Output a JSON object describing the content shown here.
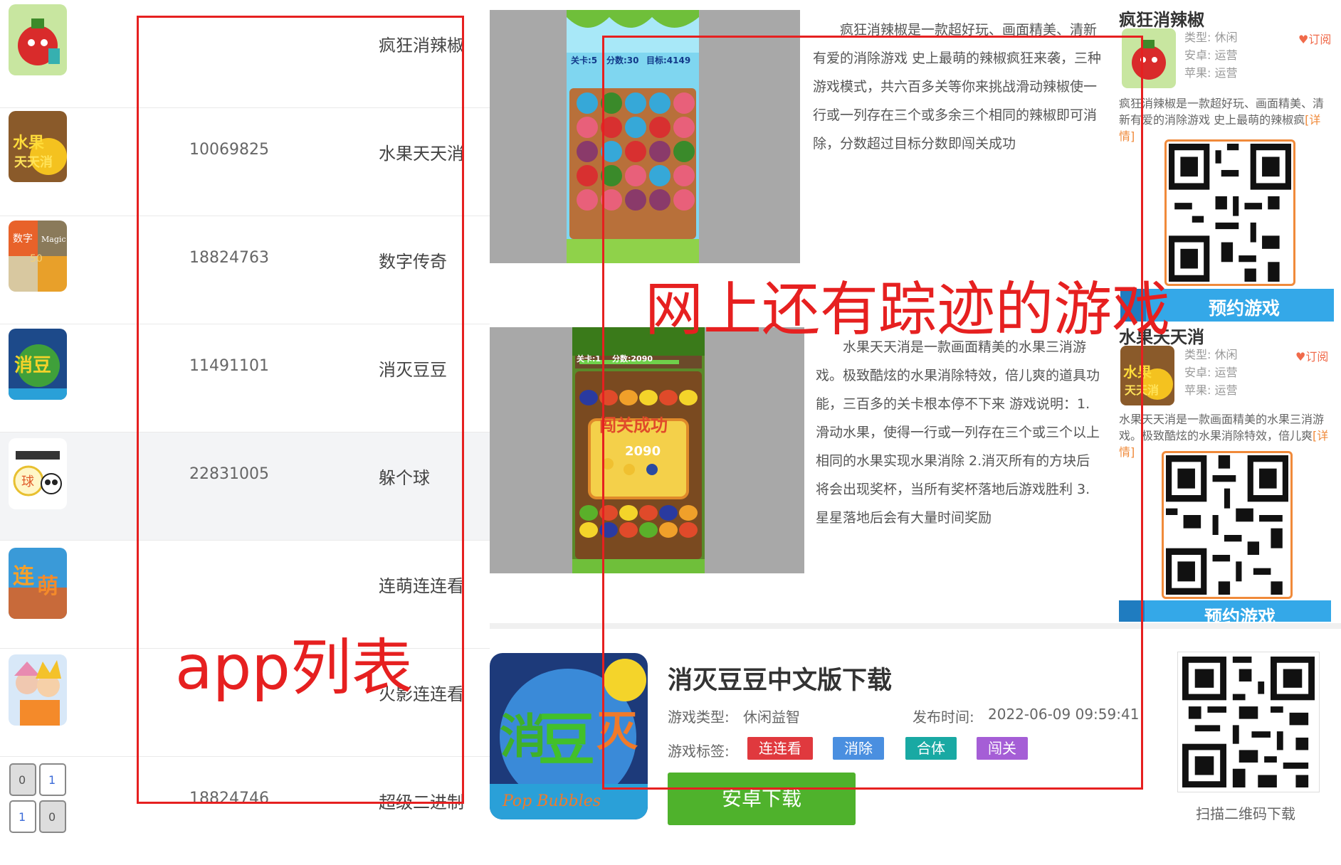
{
  "app_list": [
    {
      "icon": "red-pepper-game-icon",
      "count": "",
      "name": "疯狂消辣椒"
    },
    {
      "icon": "fruit-game-icon",
      "count": "10069825",
      "name": "水果天天消"
    },
    {
      "icon": "number-legend-icon",
      "count": "18824763",
      "name": "数字传奇"
    },
    {
      "icon": "bean-game-icon",
      "count": "11491101",
      "name": "消灭豆豆"
    },
    {
      "icon": "panda-ball-icon",
      "count": "22831005",
      "name": "躲个球"
    },
    {
      "icon": "lianmeng-icon",
      "count": "",
      "name": "连萌连连看"
    },
    {
      "icon": "naruto-icon",
      "count": "",
      "name": "火影连连看"
    },
    {
      "icon": "binary-game-icon",
      "count": "18824746",
      "name": "超级二进制"
    }
  ],
  "articles": [
    {
      "screenshot_labels": {
        "level": "关卡:5",
        "score": "分数:30",
        "target": "目标:4149"
      },
      "description": "疯狂消辣椒是一款超好玩、画面精美、清新有爱的消除游戏 史上最萌的辣椒疯狂来袭，三种游戏模式，共六百多关等你来挑战滑动辣椒使一行或一列存在三个或多余三个相同的辣椒即可消除，分数超过目标分数即闯关成功"
    },
    {
      "screenshot_labels": {
        "level": "关卡:1",
        "score": "分数:2090",
        "banner": "闯关成功",
        "popup_score": "2090"
      },
      "description": "水果天天消是一款画面精美的水果三消游戏。极致酷炫的水果消除特效，倍儿爽的道具功能，三百多的关卡根本停不下来 游戏说明：1.滑动水果，使得一行或一列存在三个或三个以上相同的水果实现水果消除 2.消灭所有的方块后将会出现奖杯，当所有奖杯落地后游戏胜利 3.星星落地后会有大量时间奖励"
    }
  ],
  "sidebar": [
    {
      "title": "疯狂消辣椒",
      "type_label": "类型:",
      "type_value": "休闲",
      "android_label": "安卓:",
      "android_value": "运营",
      "ios_label": "苹果:",
      "ios_value": "运营",
      "subscribe": "♥订阅",
      "intro": "疯狂消辣椒是一款超好玩、画面精美、清新有爱的消除游戏 史上最萌的辣椒疯",
      "more": "[详情]",
      "reserve": "预约游戏"
    },
    {
      "title": "水果天天消",
      "type_label": "类型:",
      "type_value": "休闲",
      "android_label": "安卓:",
      "android_value": "运营",
      "ios_label": "苹果:",
      "ios_value": "运营",
      "subscribe": "♥订阅",
      "intro": "水果天天消是一款画面精美的水果三消游戏。极致酷炫的水果消除特效，倍儿爽",
      "more": "[详情]",
      "reserve": "预约游戏"
    }
  ],
  "download": {
    "title": "消灭豆豆中文版下载",
    "type_label": "游戏类型:",
    "type_value": "休闲益智",
    "date_label": "发布时间:",
    "date_value": "2022-06-09 09:59:41",
    "tags_label": "游戏标签:",
    "tags": [
      {
        "label": "连连看",
        "color": "#e0393e"
      },
      {
        "label": "消除",
        "color": "#4a8fe0"
      },
      {
        "label": "合体",
        "color": "#19a9a3"
      },
      {
        "label": "闯关",
        "color": "#a55ed6"
      }
    ],
    "button": "安卓下载",
    "qr_caption": "扫描二维码下载",
    "icon_text": "Pop Bubbles"
  },
  "annotations": {
    "list_label": "app列表",
    "online_label": "网上还有踪迹的游戏",
    "color": "#e62020"
  }
}
